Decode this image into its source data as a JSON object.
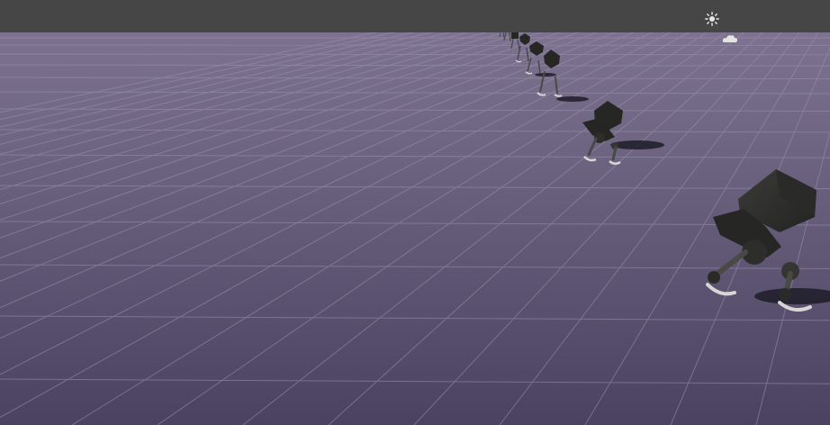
{
  "scene": {
    "colors": {
      "toolbar": "#464646",
      "ground_far": "#7d7390",
      "ground_near": "#4a4260",
      "grid_line": "#9a92ad",
      "robot_body": "#2e2e2c",
      "robot_leg": "#3c3c3a",
      "robot_foot": "#d6d6d6",
      "shadow": "#1f1c28"
    },
    "icons": {
      "light_gizmo": "sun-icon",
      "camera_gizmo": "cloud-icon"
    },
    "robot_count": 9
  }
}
